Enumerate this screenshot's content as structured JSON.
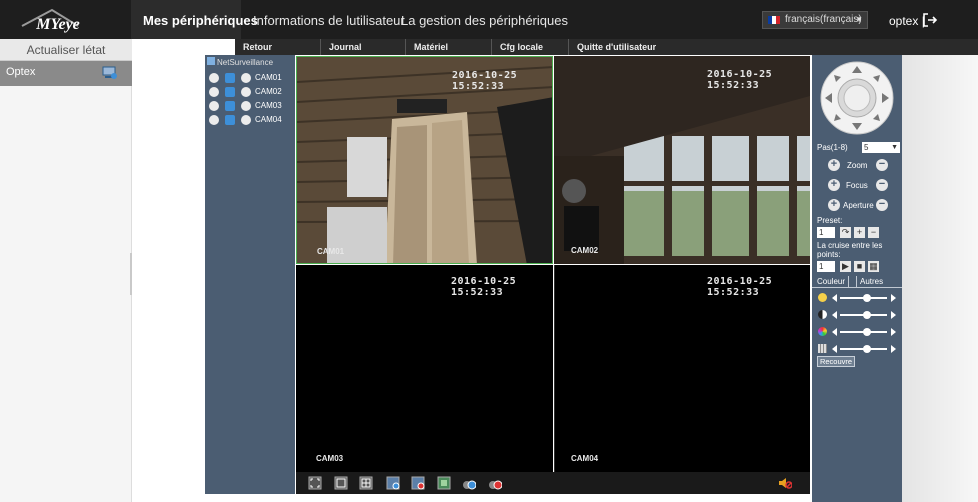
{
  "app": {
    "logo_text": "MYeye"
  },
  "topnav": {
    "items": [
      "Mes périphériques",
      "Informations de lutilisateur",
      "La gestion des périphériques"
    ],
    "language": "français(français)",
    "user": "optex",
    "separator": "|"
  },
  "left": {
    "refresh_label": "Actualiser létat",
    "device_name": "Optex",
    "collapse_glyph": "‹‹"
  },
  "tabs": [
    "Retour",
    "Journal",
    "Matériel",
    "Cfg locale",
    "Quitte d'utilisateur"
  ],
  "tree": {
    "root": "NetSurveillance",
    "cameras": [
      "CAM01",
      "CAM02",
      "CAM03",
      "CAM04"
    ]
  },
  "videos": [
    {
      "timestamp": "2016-10-25 15:52:33",
      "label": "CAM01",
      "active": true
    },
    {
      "timestamp": "2016-10-25 15:52:33",
      "label": "CAM02",
      "active": false
    },
    {
      "timestamp": "2016-10-25 15:52:33",
      "label": "CAM03",
      "active": false
    },
    {
      "timestamp": "2016-10-25 15:52:33",
      "label": "CAM04",
      "active": false
    }
  ],
  "bottom_toolbar": {
    "buttons": [
      "fullscreen-icon",
      "single-view-icon",
      "quad-view-icon",
      "record-icon",
      "stop-record-icon",
      "snapshot-icon",
      "play-all-icon",
      "stop-all-icon"
    ],
    "mute_icon": "speaker-mute-icon"
  },
  "ptz": {
    "step_label": "Pas(1-8)",
    "step_value": "5",
    "zoom_label": "Zoom",
    "focus_label": "Focus",
    "aperture_label": "Aperture",
    "preset_label": "Preset:",
    "preset_value": "1",
    "cruise_label": "La cruise entre les points:",
    "cruise_value": "1",
    "color_tab": "Couleur",
    "other_tab": "Autres",
    "recover_label": "Recouvre"
  },
  "colors": {
    "topbar": "#1e1e1e",
    "side_panel": "#4b5d72",
    "active_outline": "#4caf50"
  }
}
